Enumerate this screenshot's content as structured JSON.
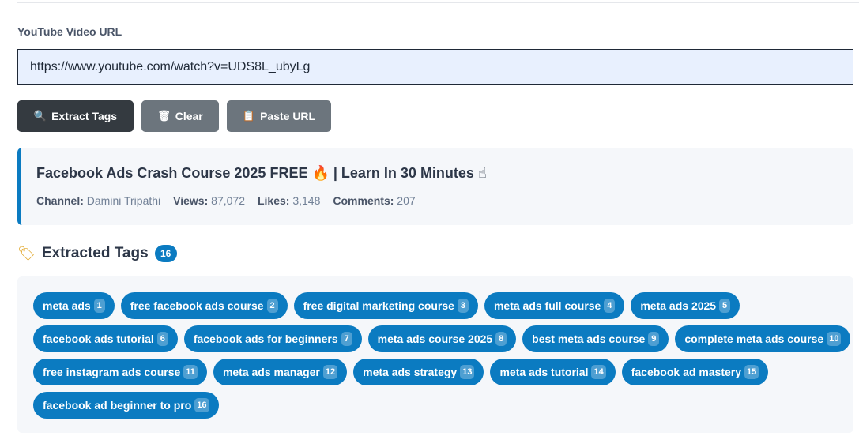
{
  "form": {
    "label": "YouTube Video URL",
    "url_value": "https://www.youtube.com/watch?v=UDS8L_ubyLg"
  },
  "buttons": {
    "extract": {
      "icon": "🔍",
      "label": "Extract Tags"
    },
    "clear": {
      "icon": "🗑",
      "label": "Clear"
    },
    "paste": {
      "icon": "📋",
      "label": "Paste URL"
    }
  },
  "video": {
    "title": "Facebook Ads Crash Course 2025 FREE 🔥 | Learn In 30 Minutes ☝",
    "channel_label": "Channel:",
    "channel": "Damini Tripathi",
    "views_label": "Views:",
    "views": "87,072",
    "likes_label": "Likes:",
    "likes": "3,148",
    "comments_label": "Comments:",
    "comments": "207"
  },
  "tags_section": {
    "icon": "🏷",
    "title": "Extracted Tags",
    "count": "16"
  },
  "tags": [
    {
      "text": "meta ads",
      "num": "1"
    },
    {
      "text": "free facebook ads course",
      "num": "2"
    },
    {
      "text": "free digital marketing course",
      "num": "3"
    },
    {
      "text": "meta ads full course",
      "num": "4"
    },
    {
      "text": "meta ads 2025",
      "num": "5"
    },
    {
      "text": "facebook ads tutorial",
      "num": "6"
    },
    {
      "text": "facebook ads for beginners",
      "num": "7"
    },
    {
      "text": "meta ads course 2025",
      "num": "8"
    },
    {
      "text": "best meta ads course",
      "num": "9"
    },
    {
      "text": "complete meta ads course",
      "num": "10"
    },
    {
      "text": "free instagram ads course",
      "num": "11"
    },
    {
      "text": "meta ads manager",
      "num": "12"
    },
    {
      "text": "meta ads strategy",
      "num": "13"
    },
    {
      "text": "meta ads tutorial",
      "num": "14"
    },
    {
      "text": "facebook ad mastery",
      "num": "15"
    },
    {
      "text": "facebook ad beginner to pro",
      "num": "16"
    }
  ]
}
